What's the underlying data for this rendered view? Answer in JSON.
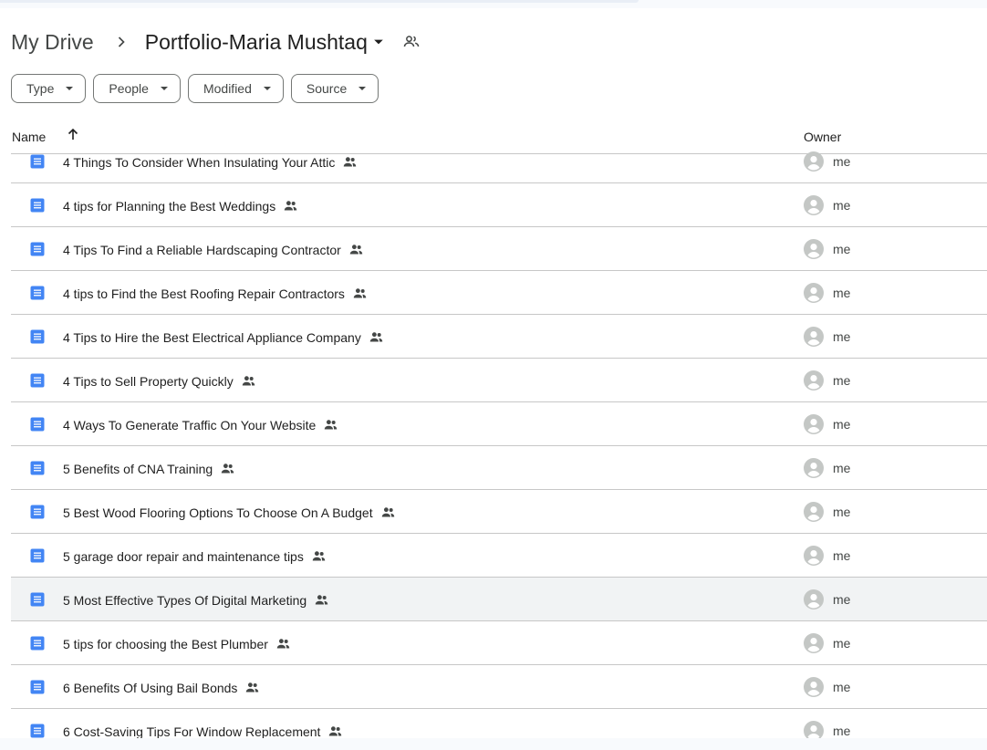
{
  "breadcrumb": {
    "root": "My Drive",
    "current": "Portfolio-Maria Mushtaq"
  },
  "icons": {
    "separator": "chevron-right-icon",
    "caret": "arrow-drop-down-icon",
    "shared": "people-icon",
    "doc": "google-doc-icon",
    "avatar": "account-circle-icon",
    "sort": "arrow-upward-icon"
  },
  "colors": {
    "doc_blue": "#4285f4",
    "avatar_grey": "#c4c7c5",
    "hover_row": "#f1f3f4"
  },
  "filters": [
    {
      "label": "Type"
    },
    {
      "label": "People"
    },
    {
      "label": "Modified"
    },
    {
      "label": "Source"
    }
  ],
  "table": {
    "col_name": "Name",
    "col_owner": "Owner",
    "sort": "ascending",
    "rows": [
      {
        "name": "4 Things To Consider When Insulating Your Attic",
        "owner": "me"
      },
      {
        "name": "4 tips for Planning the Best Weddings",
        "owner": "me"
      },
      {
        "name": "4 Tips To Find a Reliable Hardscaping Contractor",
        "owner": "me"
      },
      {
        "name": "4 tips to Find the Best Roofing Repair Contractors",
        "owner": "me"
      },
      {
        "name": "4 Tips to Hire the Best Electrical Appliance Company",
        "owner": "me"
      },
      {
        "name": "4 Tips to Sell Property Quickly",
        "owner": "me"
      },
      {
        "name": "4 Ways To Generate Traffic On Your Website",
        "owner": "me"
      },
      {
        "name": "5 Benefits of CNA Training",
        "owner": "me"
      },
      {
        "name": "5 Best Wood Flooring Options To Choose On A Budget",
        "owner": "me"
      },
      {
        "name": "5 garage door repair and maintenance tips",
        "owner": "me"
      },
      {
        "name": "5 Most Effective Types Of Digital Marketing",
        "owner": "me",
        "highlighted": true
      },
      {
        "name": "5 tips for choosing the Best Plumber",
        "owner": "me"
      },
      {
        "name": "6 Benefits Of Using Bail Bonds",
        "owner": "me"
      },
      {
        "name": "6 Cost-Saving Tips For Window Replacement",
        "owner": "me"
      }
    ]
  }
}
